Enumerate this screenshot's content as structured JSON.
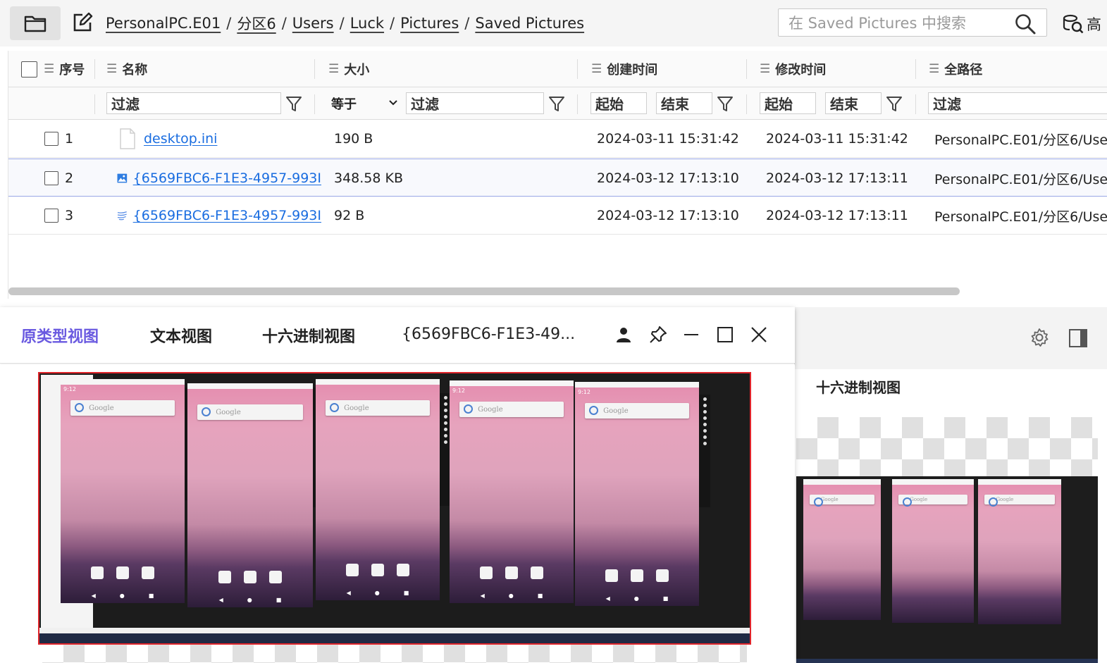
{
  "toolbar": {
    "breadcrumb": [
      "PersonalPC.E01",
      "分区6",
      "Users",
      "Luck",
      "Pictures",
      "Saved Pictures"
    ],
    "search_placeholder": "在 Saved Pictures 中搜索",
    "advanced_label": "高"
  },
  "table": {
    "columns": {
      "index": "序号",
      "name": "名称",
      "size": "大小",
      "created": "创建时间",
      "modified": "修改时间",
      "fullpath": "全路径"
    },
    "filters": {
      "name_placeholder": "过滤",
      "size_operator": "等于",
      "size_placeholder": "过滤",
      "created_start": "起始",
      "created_end": "结束",
      "modified_start": "起始",
      "modified_end": "结束",
      "path_placeholder": "过滤"
    },
    "rows": [
      {
        "index": "1",
        "name": "desktop.ini",
        "size": "190 B",
        "created": "2024-03-11 15:31:42",
        "modified": "2024-03-11 15:31:42",
        "path": "PersonalPC.E01/分区6/Use",
        "icon": "file-icon"
      },
      {
        "index": "2",
        "name": "{6569FBC6-F1E3-4957-993I",
        "size": "348.58 KB",
        "created": "2024-03-12 17:13:10",
        "modified": "2024-03-12 17:13:11",
        "path": "PersonalPC.E01/分区6/Use",
        "icon": "image-icon"
      },
      {
        "index": "3",
        "name": "{6569FBC6-F1E3-4957-993I",
        "size": "92 B",
        "created": "2024-03-12 17:13:10",
        "modified": "2024-03-12 17:13:11",
        "path": "PersonalPC.E01/分区6/Use",
        "icon": "text-lines-icon"
      }
    ]
  },
  "viewer": {
    "tabs": [
      "原类型视图",
      "文本视图",
      "十六进制视图"
    ],
    "active_tab": 0,
    "title": "{6569FBC6-F1E3-49...",
    "active_color": "#6a5ae0"
  },
  "right_panel": {
    "title": "十六进制视图"
  },
  "preview": {
    "phone_time": "9:12",
    "search_hint": "Google"
  }
}
